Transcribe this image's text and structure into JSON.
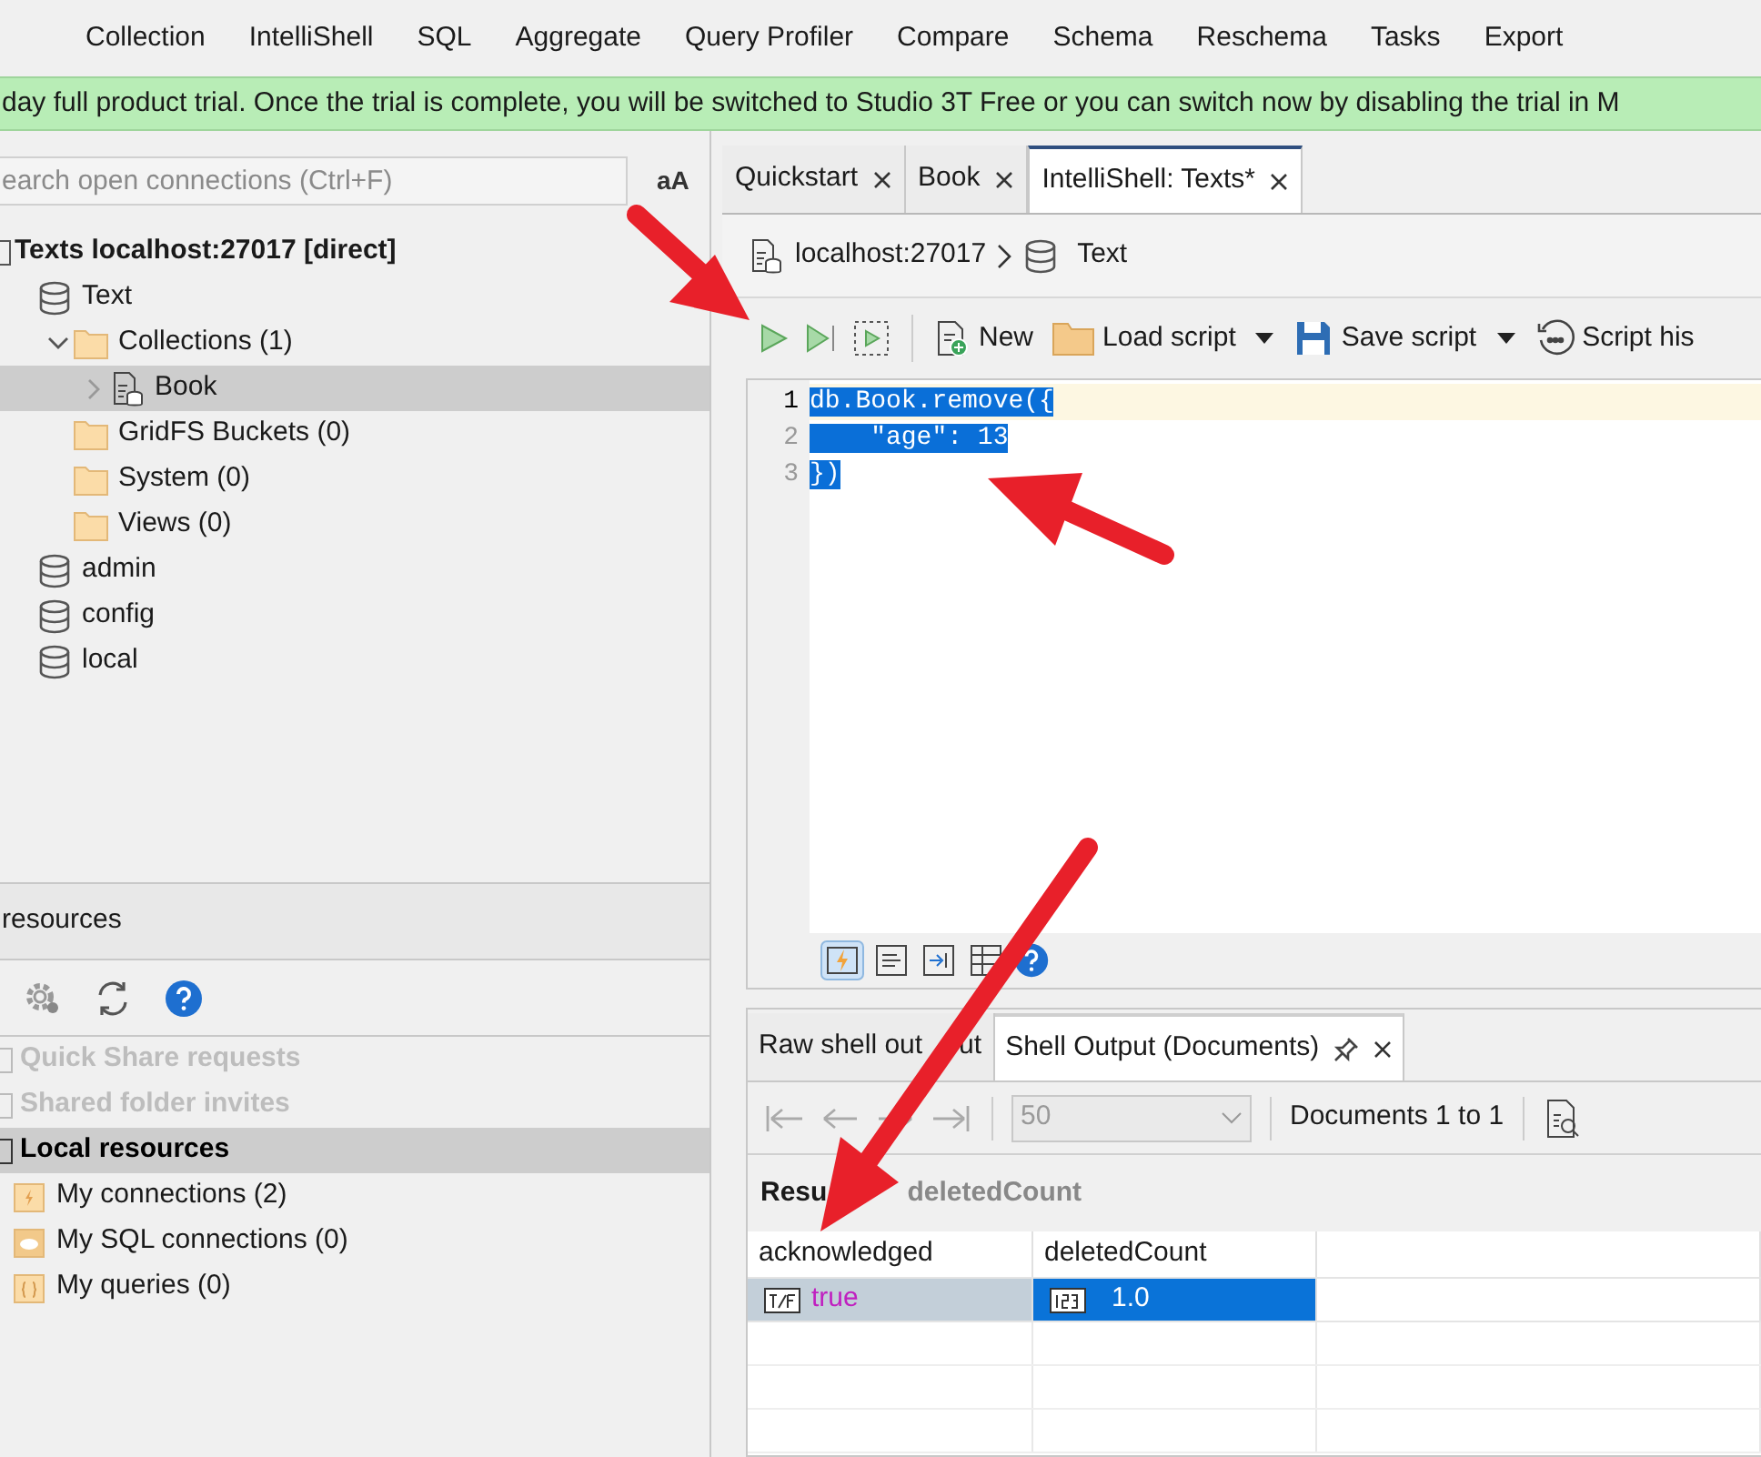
{
  "menu": [
    "Collection",
    "IntelliShell",
    "SQL",
    "Aggregate",
    "Query Profiler",
    "Compare",
    "Schema",
    "Reschema",
    "Tasks",
    "Export"
  ],
  "banner": "day full product trial. Once the trial is complete, you will be switched to Studio 3T Free or you can switch now by disabling the trial in M",
  "search": {
    "placeholder": "earch open connections (Ctrl+F)",
    "case_toggle": "aA"
  },
  "tree": [
    {
      "kind": "connection",
      "label": "Texts localhost:27017 [direct]",
      "selected": false,
      "children": [
        {
          "kind": "database",
          "label": "Text",
          "selected": false,
          "children": [
            {
              "kind": "folder",
              "label": "Collections (1)",
              "selected": false,
              "expanded": true,
              "children": [
                {
                  "kind": "collection",
                  "label": "Book",
                  "selected": true,
                  "expanded": false
                }
              ]
            },
            {
              "kind": "folder",
              "label": "GridFS Buckets (0)",
              "selected": false
            },
            {
              "kind": "folder",
              "label": "System (0)",
              "selected": false
            },
            {
              "kind": "folder",
              "label": "Views (0)",
              "selected": false
            }
          ]
        },
        {
          "kind": "database",
          "label": "admin",
          "selected": false
        },
        {
          "kind": "database",
          "label": "config",
          "selected": false
        },
        {
          "kind": "database",
          "label": "local",
          "selected": false
        }
      ]
    }
  ],
  "resources": {
    "title": "resources",
    "items": [
      {
        "kind": "group",
        "label": "Quick Share requests",
        "disabled": true,
        "selected": false
      },
      {
        "kind": "group",
        "label": "Shared folder invites",
        "disabled": true,
        "selected": false
      },
      {
        "kind": "group",
        "label": "Local resources",
        "disabled": false,
        "selected": true,
        "children": [
          {
            "kind": "connections",
            "label": "My connections (2)"
          },
          {
            "kind": "sql",
            "label": "My SQL connections (0)"
          },
          {
            "kind": "queries",
            "label": "My queries (0)"
          }
        ]
      }
    ]
  },
  "tabs": [
    {
      "label": "Quickstart",
      "selected": false
    },
    {
      "label": "Book",
      "selected": false
    },
    {
      "label": "IntelliShell: Texts*",
      "selected": true
    }
  ],
  "breadcrumb": [
    "localhost:27017",
    "Text"
  ],
  "toolbar": [
    {
      "kind": "button",
      "label": "New"
    },
    {
      "kind": "dropdown",
      "label": "Load script"
    },
    {
      "kind": "dropdown",
      "label": "Save script"
    },
    {
      "kind": "button",
      "label": "Script his"
    }
  ],
  "editor": {
    "lines": [
      {
        "number": "1",
        "code": "db.Book.remove({",
        "current": true,
        "selected": true
      },
      {
        "number": "2",
        "code": "    \"age\": 13",
        "current": false,
        "selected": true
      },
      {
        "number": "3",
        "code": "})",
        "current": false,
        "selected": true
      }
    ]
  },
  "output": {
    "tabs": [
      {
        "label": "Raw shell out",
        "label_tail": "ut",
        "selected": false
      },
      {
        "label": "Shell Output (Documents)",
        "selected": true
      }
    ],
    "page_size": "50",
    "range": "Documents 1 to 1",
    "result_label": "Resu",
    "result_name": "deletedCount",
    "columns": [
      "acknowledged",
      "deletedCount"
    ],
    "rows": [
      {
        "cells": [
          {
            "kind": "boolean",
            "value": "true",
            "selected": false
          },
          {
            "kind": "number",
            "value": "1.0",
            "selected": true
          }
        ]
      }
    ]
  }
}
